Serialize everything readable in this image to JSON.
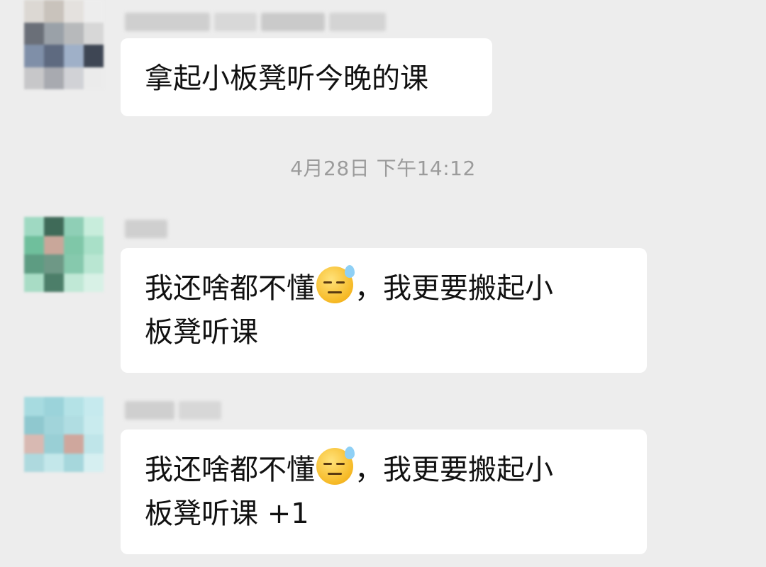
{
  "chat": {
    "timestamp": "4月28日 下午14:12",
    "messages": [
      {
        "lines": [
          "拿起小板凳听今晚的课"
        ]
      },
      {
        "line1_before_emoji": "我还啥都不懂",
        "line1_after_emoji": "，我更要搬起小",
        "line2": "板凳听课",
        "emoji": "downcast-face-with-sweat-icon"
      },
      {
        "line1_before_emoji": "我还啥都不懂",
        "line1_after_emoji": "，我更要搬起小",
        "line2": "板凳听课 +1",
        "emoji": "downcast-face-with-sweat-icon"
      }
    ]
  },
  "colors": {
    "background": "#ededed",
    "bubble": "#ffffff",
    "text": "#111111",
    "timestamp": "#9b9b9b"
  }
}
